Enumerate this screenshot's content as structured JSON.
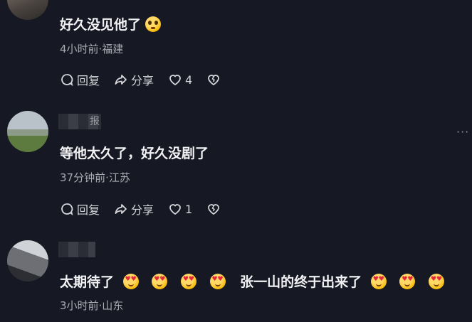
{
  "comments": [
    {
      "username": "",
      "text": "好久没见他了",
      "emoji": "pleading-face",
      "meta": "4小时前·福建",
      "reply_label": "回复",
      "share_label": "分享",
      "like_count": "4"
    },
    {
      "username": "报",
      "text": "等他太久了，好久没剧了",
      "meta": "37分钟前·江苏",
      "reply_label": "回复",
      "share_label": "分享",
      "like_count": "1"
    },
    {
      "username": "",
      "text_part1": "太期待了",
      "text_part2": "张一山的终于出来了",
      "emoji": "heart-eyes",
      "meta": "3小时前·山东"
    }
  ],
  "more_icon": "···",
  "colors": {
    "background": "#161823",
    "text": "#f2f2f4",
    "meta": "#a9aab2"
  }
}
